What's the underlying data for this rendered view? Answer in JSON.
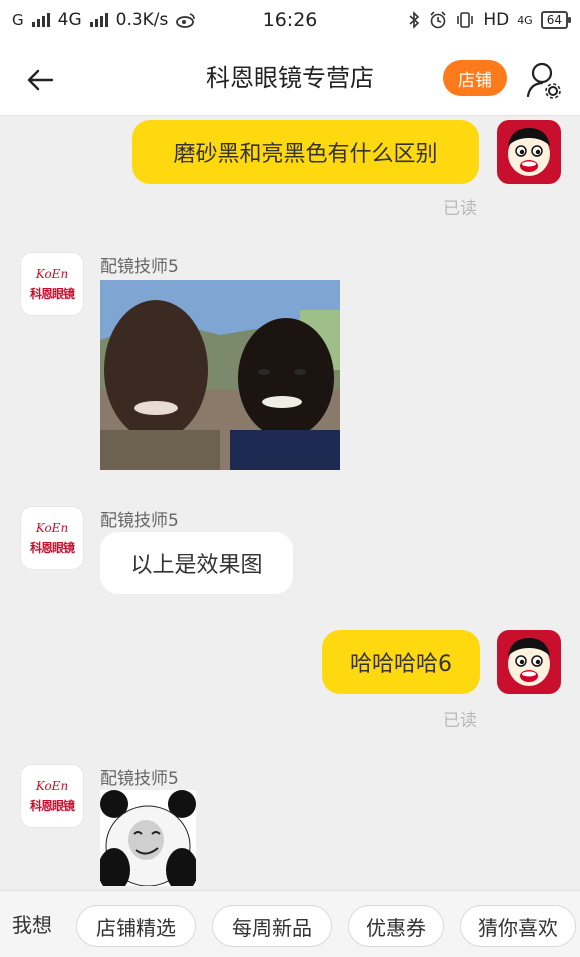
{
  "status_bar": {
    "network": "4G",
    "speed": "0.3K/s",
    "time": "16:26",
    "right_label": "HD",
    "battery": "64"
  },
  "header": {
    "title": "科恩眼镜专营店",
    "store_button": "店铺"
  },
  "messages": [
    {
      "type": "text",
      "side": "right",
      "text": "磨砂黑和亮黑色有什么区别",
      "read": "已读"
    },
    {
      "type": "image",
      "side": "left",
      "sender": "配镜技师5"
    },
    {
      "type": "text",
      "side": "left",
      "sender": "配镜技师5",
      "text": "以上是效果图"
    },
    {
      "type": "text",
      "side": "right",
      "text": "哈哈哈哈6",
      "read": "已读"
    },
    {
      "type": "sticker",
      "side": "left",
      "sender": "配镜技师5"
    }
  ],
  "shop_logo": {
    "brand_top": "KoEn",
    "brand_bottom": "科恩眼镜"
  },
  "bottom_bar": {
    "lead": "我想",
    "chips": [
      "店铺精选",
      "每周新品",
      "优惠券",
      "猜你喜欢"
    ]
  },
  "colors": {
    "accent": "#ff7a1a",
    "bubble_yellow": "#ffd90f",
    "background": "#efefef"
  },
  "icons": [
    "back-arrow-icon",
    "user-settings-icon",
    "bluetooth-icon",
    "alarm-icon",
    "vibrate-icon",
    "weibo-icon"
  ]
}
